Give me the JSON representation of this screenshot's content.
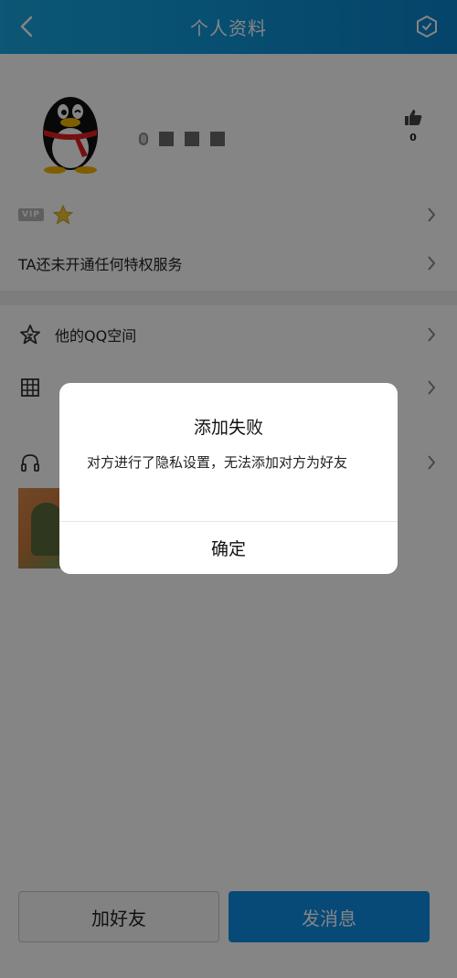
{
  "header": {
    "title": "个人资料",
    "back_icon": "chevron-left-icon",
    "settings_icon": "hexagon-settings-icon",
    "background": "#0f97d8"
  },
  "profile": {
    "avatar_icon": "qq-penguin-avatar",
    "likes_icon": "thumbs-up-icon",
    "likes_count": "0"
  },
  "vip": {
    "badge_text": "VIP",
    "star_icon": "star-icon"
  },
  "privilege": {
    "text": "TA还未开通任何特权服务"
  },
  "menu": {
    "qzone_label": "他的QQ空间",
    "qzone_icon": "star-outline-icon",
    "album_icon": "grid-icon",
    "music_icon": "headphones-icon"
  },
  "bottom": {
    "add_friend_label": "加好友",
    "send_message_label": "发消息",
    "accent_color": "#0f8fe6"
  },
  "dialog": {
    "title": "添加失败",
    "message": "对方进行了隐私设置，无法添加对方为好友",
    "confirm_label": "确定"
  }
}
